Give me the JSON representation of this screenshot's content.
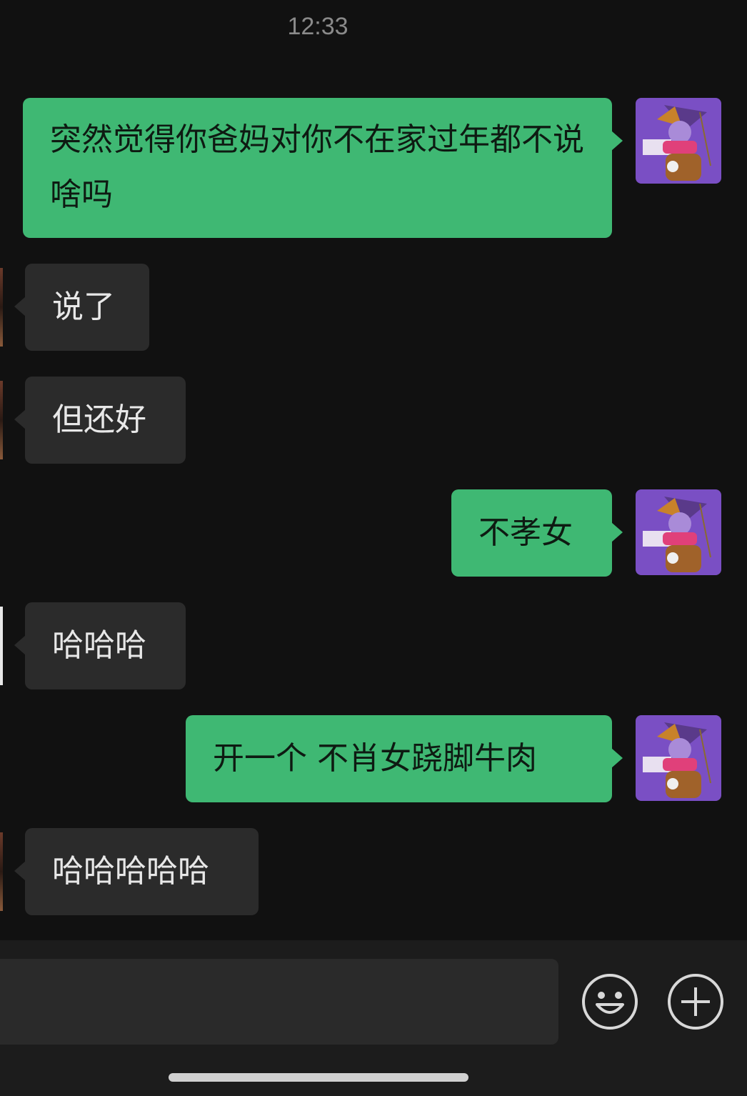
{
  "status": {
    "time": "12:33"
  },
  "messages": [
    {
      "sender": "me",
      "text": "突然觉得你爸妈对你不在家过年都不说啥吗"
    },
    {
      "sender": "them",
      "text": "说了"
    },
    {
      "sender": "them",
      "text": "但还好"
    },
    {
      "sender": "me",
      "text": "不孝女"
    },
    {
      "sender": "them",
      "text": "哈哈哈"
    },
    {
      "sender": "me",
      "text": "开一个 不肖女跷脚牛肉"
    },
    {
      "sender": "them",
      "text": "哈哈哈哈哈"
    }
  ],
  "input": {
    "value": "",
    "emoji_icon": "emoji-face-icon",
    "add_icon": "plus-circle-icon"
  },
  "colors": {
    "background": "#111111",
    "my_bubble": "#3fb873",
    "their_bubble": "#2b2b2b"
  }
}
